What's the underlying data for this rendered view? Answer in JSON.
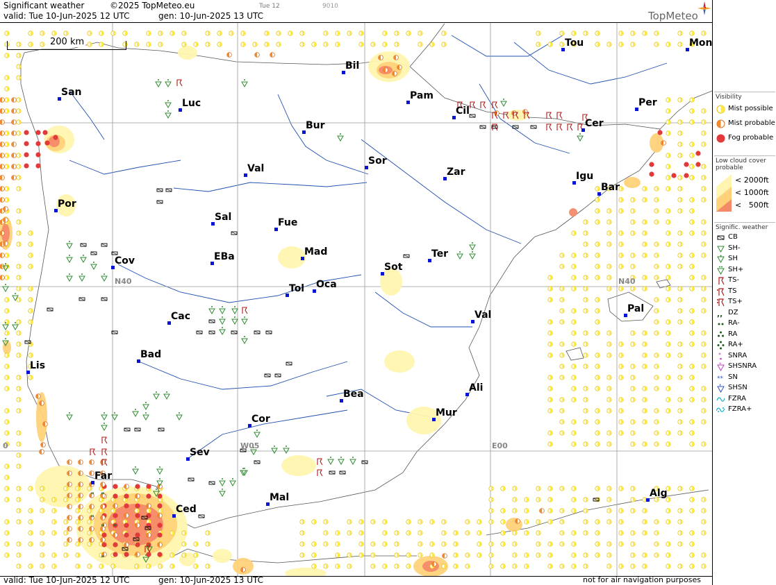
{
  "header": {
    "title": "Significant weather",
    "copyright": "©2025 TopMeteo.eu",
    "tab_day": "Tue 12",
    "code": "9010",
    "valid_line": "valid:  Tue  10-Jun-2025  12 UTC",
    "gen_line": "gen: 10-Jun-2025 13 UTC",
    "logo_text": "TopMeteo"
  },
  "map": {
    "scale_label": "200 km",
    "cities": [
      {
        "name": "San"
      },
      {
        "name": "Luc"
      },
      {
        "name": "Bil"
      },
      {
        "name": "Pam"
      },
      {
        "name": "Tou"
      },
      {
        "name": "Mon"
      },
      {
        "name": "Cil"
      },
      {
        "name": "Per"
      },
      {
        "name": "Cer"
      },
      {
        "name": "Bur"
      },
      {
        "name": "Val"
      },
      {
        "name": "Sor"
      },
      {
        "name": "Zar"
      },
      {
        "name": "Igu"
      },
      {
        "name": "Bar"
      },
      {
        "name": "Por"
      },
      {
        "name": "Sal"
      },
      {
        "name": "Fue"
      },
      {
        "name": "Mad"
      },
      {
        "name": "EBa"
      },
      {
        "name": "Cov"
      },
      {
        "name": "Sot"
      },
      {
        "name": "Ter"
      },
      {
        "name": "Tol"
      },
      {
        "name": "Oca"
      },
      {
        "name": "Cac"
      },
      {
        "name": "Pal"
      },
      {
        "name": "Val"
      },
      {
        "name": "Bad"
      },
      {
        "name": "Lis"
      },
      {
        "name": "Bea"
      },
      {
        "name": "Ali"
      },
      {
        "name": "Cor"
      },
      {
        "name": "Mur"
      },
      {
        "name": "Sev"
      },
      {
        "name": "Far"
      },
      {
        "name": "Mal"
      },
      {
        "name": "Alg"
      },
      {
        "name": "Ced"
      }
    ],
    "grid_labels": {
      "n40_left": "N40",
      "n40_right": "N40",
      "w05": "W05",
      "e00": "E00",
      "zero": "0"
    },
    "colors": {
      "mist": "#ffe84a",
      "fog": "#e03a3a",
      "low_cloud_2000": "#fff5b0",
      "low_cloud_1000": "#ffd27a",
      "low_cloud_500": "#f58a6a",
      "city": "#0a14d4",
      "river": "#1f4fb0",
      "shower": "#2e8b2e",
      "storm": "#b21818"
    }
  },
  "footer": {
    "valid_line": "valid:  Tue  10-Jun-2025  12 UTC",
    "gen_line": "gen: 10-Jun-2025 13 UTC",
    "notice": "not for air navigation purposes"
  },
  "legend": {
    "visibility": {
      "title": "Visibility",
      "items": [
        "Mist possible",
        "Mist probable",
        "Fog probable"
      ]
    },
    "low_cloud": {
      "title": "Low cloud cover probable",
      "items": [
        "< 2000ft",
        "< 1000ft",
        "<   500ft"
      ]
    },
    "sigwx": {
      "title": "Signific. weather",
      "items": [
        "CB",
        "SH-",
        "SH",
        "SH+",
        "TS-",
        "TS",
        "TS+",
        "DZ",
        "RA-",
        "RA",
        "RA+",
        "SNRA",
        "SHSNRA",
        "SN",
        "SHSN",
        "FZRA",
        "FZRA+"
      ]
    }
  }
}
